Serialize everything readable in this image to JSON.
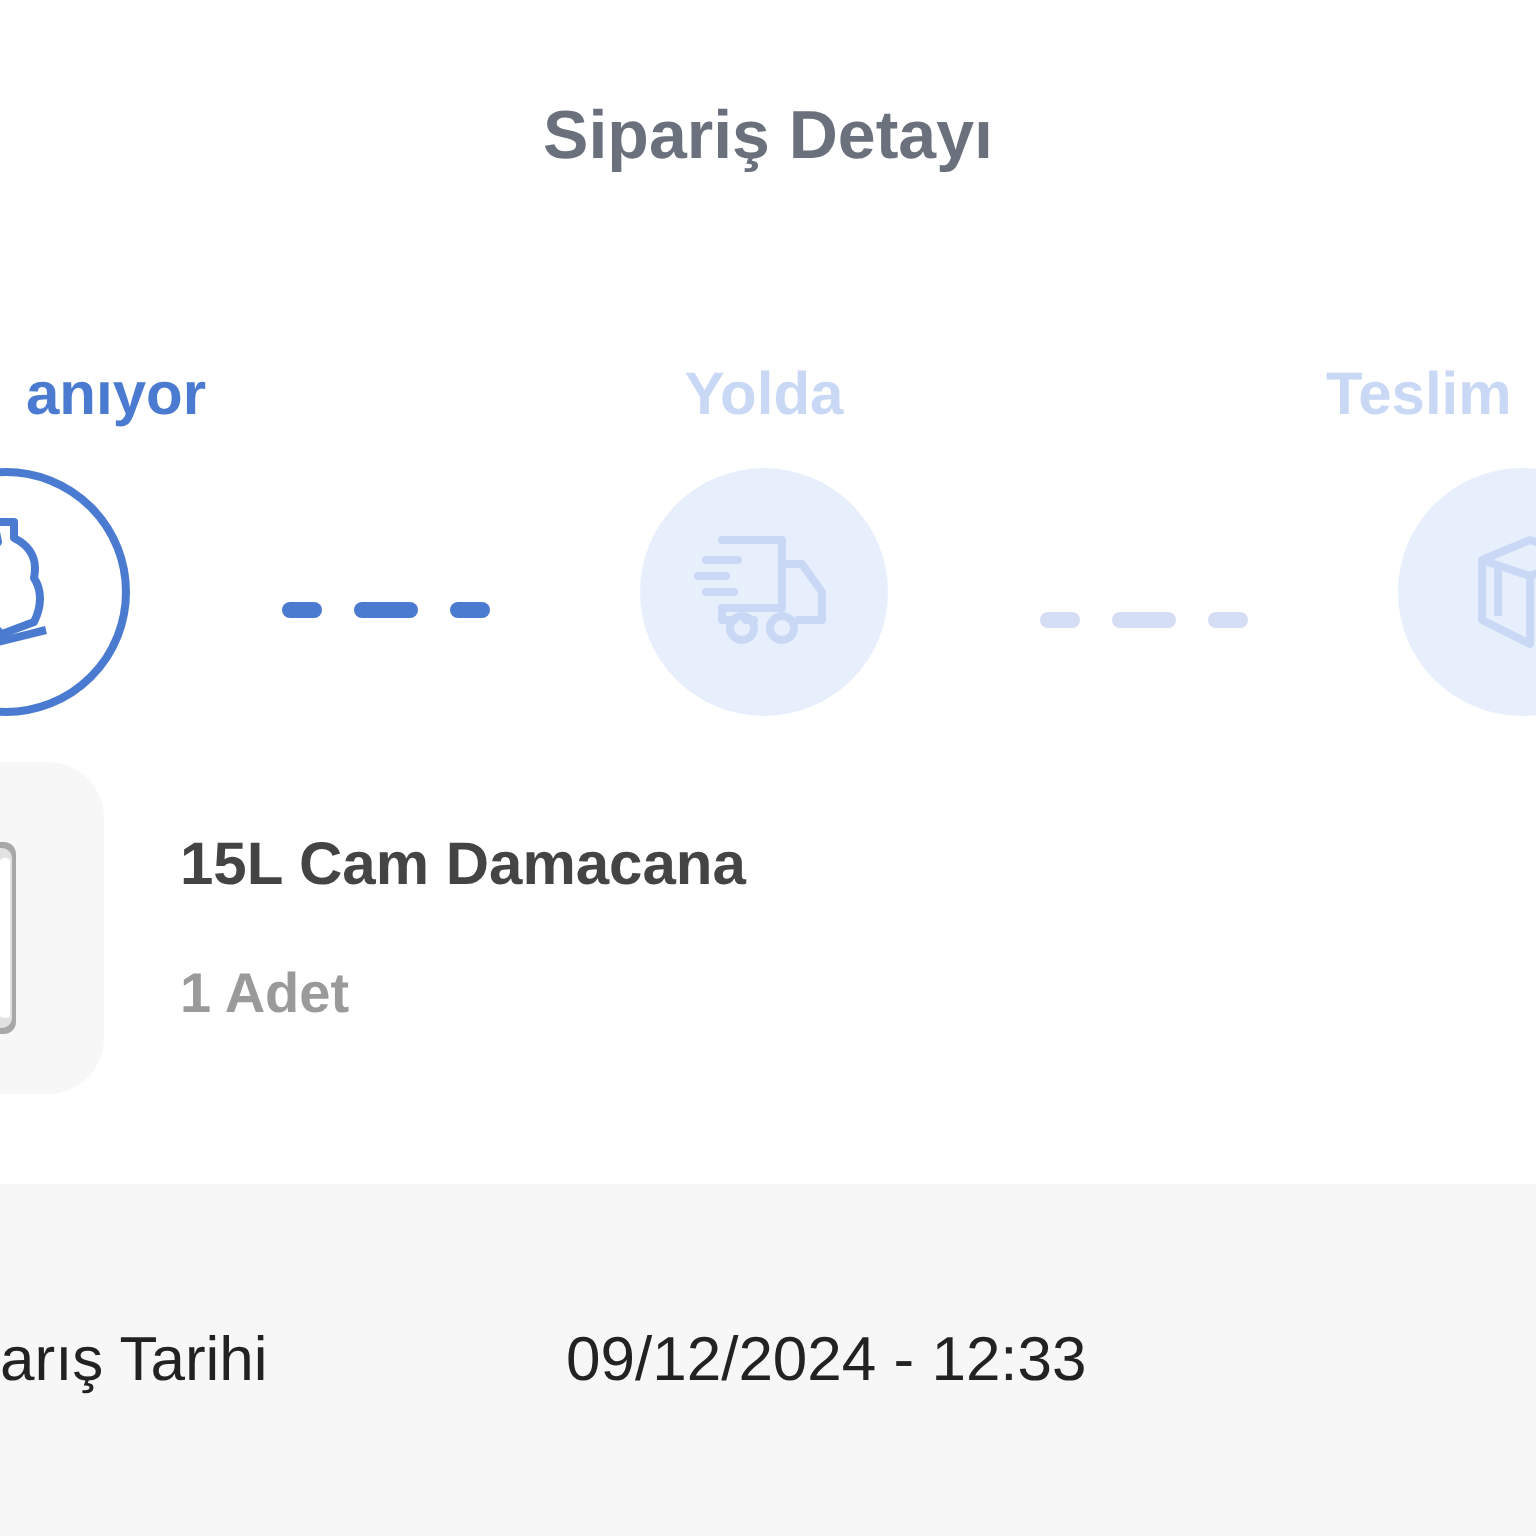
{
  "title": "Sipariş Detayı",
  "steps": [
    {
      "label": "anıyor",
      "selected": true,
      "kind": "bottle"
    },
    {
      "label": "Yolda",
      "selected": false,
      "kind": "truck"
    },
    {
      "label": "Teslim",
      "selected": false,
      "kind": "box"
    }
  ],
  "connectors": [
    {
      "done": true
    },
    {
      "done": false
    }
  ],
  "product": {
    "name": "15L Cam Damacana",
    "quantity": "1 Adet"
  },
  "details": [
    {
      "label": "arış Tarihi",
      "value": "09/12/2024 - 12:33"
    }
  ]
}
